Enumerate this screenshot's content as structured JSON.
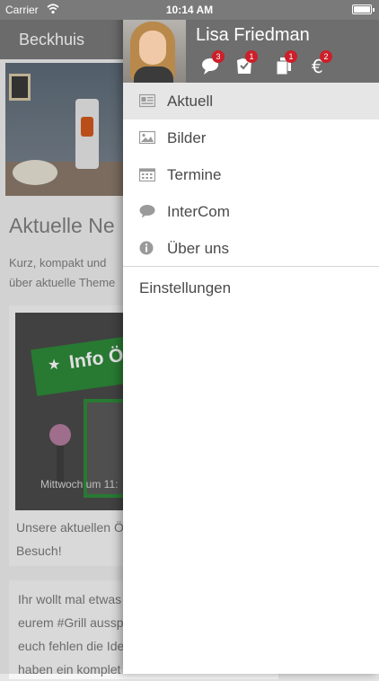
{
  "status_bar": {
    "carrier": "Carrier",
    "time": "10:14 AM"
  },
  "background": {
    "nav_title": "Beckhuis",
    "heading": "Aktuelle Ne",
    "intro_lines": [
      "Kurz, kompakt und",
      "über aktuelle Theme"
    ],
    "card1": {
      "banner_text": "Info Ö",
      "image_caption": "Mittwoch um 11:",
      "caption_lines": [
        "Unsere aktuellen Ö",
        "Besuch!"
      ]
    },
    "card2": {
      "text_lines": [
        "Ihr wollt mal etwas",
        "eurem #Grill ausspr",
        "euch fehlen die Ide",
        "haben ein komplet"
      ]
    }
  },
  "drawer": {
    "user_name": "Lisa Friedman",
    "header_icons": [
      {
        "name": "chat-icon",
        "badge": "3"
      },
      {
        "name": "checklist-icon",
        "badge": "1"
      },
      {
        "name": "documents-icon",
        "badge": "1"
      },
      {
        "name": "euro-icon",
        "badge": "2"
      }
    ],
    "menu": [
      {
        "label": "Aktuell",
        "icon": "newspaper-icon",
        "active": true
      },
      {
        "label": "Bilder",
        "icon": "image-icon",
        "active": false
      },
      {
        "label": "Termine",
        "icon": "calendar-icon",
        "active": false
      },
      {
        "label": "InterCom",
        "icon": "speech-bubble-icon",
        "active": false
      },
      {
        "label": "Über uns",
        "icon": "info-icon",
        "active": false
      }
    ],
    "settings_label": "Einstellungen"
  },
  "colors": {
    "header_gray": "#6e6e6e",
    "badge_red": "#cc1f2a",
    "active_row": "#e6e6e6"
  }
}
